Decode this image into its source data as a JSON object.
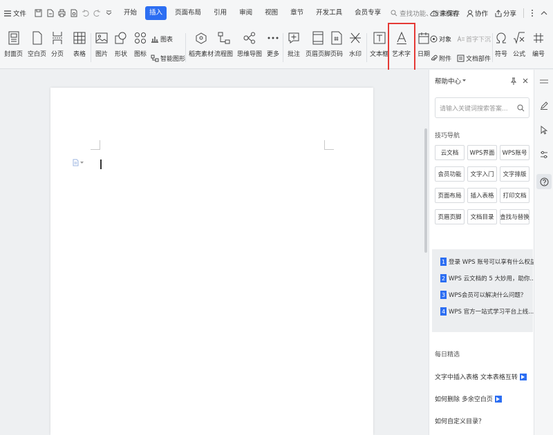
{
  "menu": {
    "label": "文件"
  },
  "tabs": [
    "开始",
    "插入",
    "页面布局",
    "引用",
    "审阅",
    "视图",
    "章节",
    "开发工具",
    "会员专享"
  ],
  "search": {
    "placeholder": "查找功能、搜索模板"
  },
  "topright": {
    "unsaved": "未保存",
    "collab": "协作",
    "share": "分享"
  },
  "ribbon": {
    "cover": "封面页",
    "blank": "空白页",
    "pagebreak": "分页",
    "table": "表格",
    "picture": "图片",
    "shape": "形状",
    "icons": "图标",
    "chart": "图表",
    "smartart": "智能图形",
    "stock": "稻壳素材",
    "flow": "流程图",
    "mind": "思维导图",
    "more": "更多",
    "comment": "批注",
    "headerfooter": "页眉页脚",
    "pagenum": "页码",
    "watermark": "水印",
    "textbox": "文本框",
    "wordart": "艺术字",
    "date": "日期",
    "object": "对象",
    "attachment": "附件",
    "dropcap": "首字下沉",
    "docpart": "文档部件",
    "symbol": "符号",
    "formula": "公式",
    "numbering": "编号"
  },
  "accent": "#2c6ef2",
  "highlight_color": "#e53935",
  "panel": {
    "title": "帮助中心",
    "search_placeholder": "请输入关键词搜索答案...",
    "tips_title": "技巧导航",
    "tips": [
      "云文档",
      "WPS界面",
      "WPS账号",
      "会员功能",
      "文字入门",
      "文字排版",
      "页面布局",
      "插入表格",
      "打印文档",
      "页眉页脚",
      "文档目录",
      "查找与替换"
    ],
    "questions": [
      {
        "n": "1",
        "text": "登录 WPS 账号可以享有什么权益"
      },
      {
        "n": "2",
        "text": "WPS 云文档的 5 大妙用，助你..."
      },
      {
        "n": "3",
        "text": "WPS会员可以解决什么问题？"
      },
      {
        "n": "4",
        "text": "WPS 官方一站式学习平台上线..."
      }
    ],
    "daily_title": "每日精选",
    "daily": [
      "文字中插入表格 文本表格互转",
      "如何删除 多余空白页",
      "如何自定义目录？"
    ]
  }
}
